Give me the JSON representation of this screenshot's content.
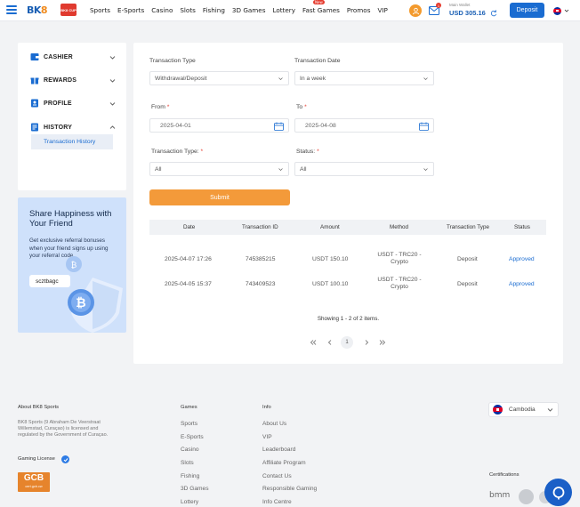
{
  "header": {
    "logo": "BK8",
    "sublogo": "BK8 CUP",
    "nav": [
      "Sports",
      "E-Sports",
      "Casino",
      "Slots",
      "Fishing",
      "3D Games",
      "Lottery",
      "Fast Games",
      "Promos",
      "VIP"
    ],
    "nav_badge": "New",
    "mail_count": "1",
    "wallet_label": "Main Wallet",
    "wallet_amount": "USD 305.16",
    "deposit": "Deposit"
  },
  "sidebar": {
    "items": [
      {
        "label": "CASHIER",
        "icon": "cashier-icon",
        "expanded": false
      },
      {
        "label": "REWARDS",
        "icon": "rewards-icon",
        "expanded": false
      },
      {
        "label": "PROFILE",
        "icon": "profile-icon",
        "expanded": false
      },
      {
        "label": "HISTORY",
        "icon": "history-icon",
        "expanded": true
      }
    ],
    "sub_item": "Transaction History"
  },
  "promo": {
    "title": "Share Happiness with Your Friend",
    "desc": "Get exclusive referral bonuses when your friend signs up using your referral code.",
    "code": "scztbagc"
  },
  "filters": {
    "type_label": "Transaction Type",
    "type_value": "Withdrawal/Deposit",
    "date_label": "Transaction Date",
    "date_value": "In a week",
    "from_label": "From",
    "from_value": "2025-04-01",
    "to_label": "To",
    "to_value": "2025-04-08",
    "tx_type_label": "Transaction Type:",
    "tx_type_value": "All",
    "status_label": "Status:",
    "status_value": "All",
    "required_mark": "*",
    "submit": "Submit"
  },
  "table": {
    "columns": [
      "Date",
      "Transaction ID",
      "Amount",
      "Method",
      "Transaction Type",
      "Status"
    ],
    "rows": [
      {
        "date": "2025-04-07 17:26",
        "id": "745385215",
        "amount": "USDT 150.10",
        "method_1": "USDT - TRC20 -",
        "method_2": "Crypto",
        "type": "Deposit",
        "status": "Approved"
      },
      {
        "date": "2025-04-05 15:37",
        "id": "743409523",
        "amount": "USDT 100.10",
        "method_1": "USDT - TRC20 -",
        "method_2": "Crypto",
        "type": "Deposit",
        "status": "Approved"
      }
    ],
    "showing": "Showing 1 - 2 of 2 items.",
    "page": "1"
  },
  "footer": {
    "about_title": "About BK8 Sports",
    "about_text": "BK8 Sports (9 Abraham De Veerstraat Willemstad, Curaçao) is licensed and regulated by the Government of Curaçao.",
    "license_title": "Gaming License",
    "gcb": "GCB",
    "gcb_sub": "cert.gcb.cw",
    "games_title": "Games",
    "games": [
      "Sports",
      "E-Sports",
      "Casino",
      "Slots",
      "Fishing",
      "3D Games",
      "Lottery"
    ],
    "info_title": "Info",
    "info": [
      "About Us",
      "VIP",
      "Leaderboard",
      "Affiliate Program",
      "Contact Us",
      "Responsible Gaming",
      "Info Centre"
    ],
    "language": "Cambodia",
    "cert_title": "Certifications",
    "cert_bmm": "bmm"
  },
  "colors": {
    "primary": "#1a6cd1",
    "accent": "#f39a3a",
    "approved": "#1a6cd1"
  }
}
